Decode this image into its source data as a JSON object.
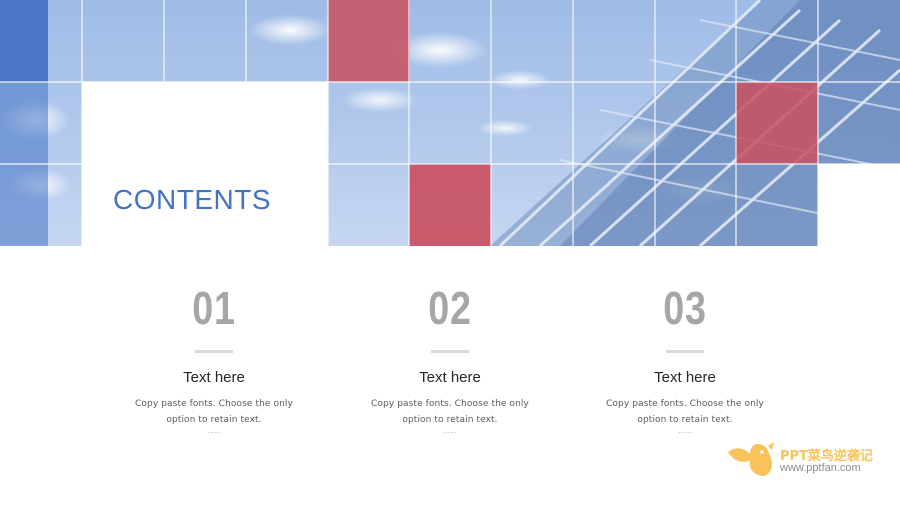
{
  "slide": {
    "title": "CONTENTS",
    "accent_color": "#4472c4",
    "highlight_color": "#c9505f"
  },
  "items": [
    {
      "number": "01",
      "heading": "Text here",
      "body": "Copy paste fonts. Choose the only option to retain text.",
      "ellipsis": "……"
    },
    {
      "number": "02",
      "heading": "Text here",
      "body": "Copy paste fonts. Choose the only option to retain text.",
      "ellipsis": "……"
    },
    {
      "number": "03",
      "heading": "Text here",
      "body": "Copy paste fonts. Choose the only option to retain text.",
      "ellipsis": "……"
    }
  ],
  "watermark": {
    "brand": "PPT菜鸟逆袭记",
    "url": "www.pptfan.com",
    "icon": "bird-logo-icon"
  }
}
